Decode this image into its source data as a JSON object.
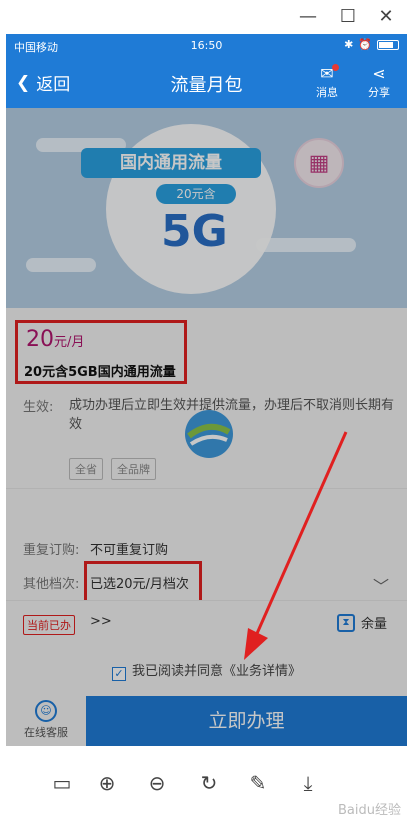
{
  "window": {
    "minimize": "—",
    "maximize": "☐",
    "close": "✕"
  },
  "status": {
    "carrier": "中国移动",
    "time": "16:50"
  },
  "nav": {
    "back_label": "返回",
    "title": "流量月包",
    "msg_label": "消息",
    "share_label": "分享"
  },
  "banner": {
    "ribbon": "国内通用流量",
    "pill": "20元含",
    "big": "5G"
  },
  "pkg": {
    "price": "20",
    "price_unit": "元/月",
    "name": "20元含5GB国内通用流量",
    "effect_label": "生效:",
    "effect_text": "成功办理后立即生效并提供流量，办理后不取消则长期有效",
    "tags": [
      "全省",
      "全品牌"
    ]
  },
  "details": {
    "repeat_label": "重复订购:",
    "repeat_value": "不可重复订购",
    "tier_label": "其他档次:",
    "tier_value": "已选20元/月档次"
  },
  "current": {
    "badge": "当前已办",
    "more": ">>",
    "balance_label": "余量"
  },
  "agree": {
    "prefix": "我已阅读并同意",
    "link": "《业务详情》"
  },
  "bottom": {
    "cs_label": "在线客服",
    "apply_label": "立即办理"
  },
  "watermark": "Baidu经验",
  "colors": {
    "primary": "#1f7bd6",
    "highlight": "#e02020",
    "price": "#b0156e"
  },
  "icons": [
    "back-icon",
    "message-icon",
    "share-icon",
    "calendar-icon",
    "chevron-down-icon",
    "hourglass-icon",
    "checkbox-icon",
    "customer-service-icon",
    "slideshow-icon",
    "zoom-in-icon",
    "zoom-out-icon",
    "rotate-icon",
    "edit-icon",
    "download-icon"
  ]
}
